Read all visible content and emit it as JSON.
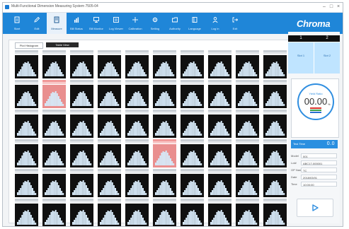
{
  "window": {
    "title": "Multi-Functional Dimension Measuring System 7505-04"
  },
  "toolbar": {
    "items": [
      {
        "label": "Start",
        "icon": "document-icon"
      },
      {
        "label": "Edit",
        "icon": "pencil-icon"
      },
      {
        "label": "Measure",
        "icon": "measure-icon",
        "active": true
      },
      {
        "label": "Bill Status",
        "icon": "bar-chart-icon"
      },
      {
        "label": "Bill Monitor",
        "icon": "monitor-icon"
      },
      {
        "label": "Log Viewer",
        "icon": "log-icon"
      },
      {
        "label": "Calibration",
        "icon": "crosshair-icon"
      },
      {
        "label": "Setting",
        "icon": "gear-icon"
      },
      {
        "label": "Authority",
        "icon": "folder-icon"
      },
      {
        "label": "Language",
        "icon": "book-icon"
      },
      {
        "label": "Log in",
        "icon": "user-icon"
      },
      {
        "label": "Exit",
        "icon": "exit-icon"
      }
    ],
    "brand": "Chroma"
  },
  "tabs": [
    "Plot Histogram",
    "Table View"
  ],
  "grid": {
    "rows": 6,
    "cols": 10,
    "highlighted": [
      [
        1,
        1
      ],
      [
        3,
        5
      ]
    ]
  },
  "right_panel": {
    "slots": [
      {
        "number": "1",
        "status": "Slot 1"
      },
      {
        "number": "2",
        "status": "Slot 2"
      }
    ],
    "gauge": {
      "label": "Yield Ratio",
      "value": "00.00",
      "unit": "%"
    },
    "test_time": {
      "label": "Test Time",
      "value": "0.0"
    },
    "info": [
      {
        "key": "Model",
        "value": "001"
      },
      {
        "key": "Lot#",
        "value": "ABC17-000001"
      },
      {
        "key": "OP Name",
        "value": "TC"
      },
      {
        "key": "Date",
        "value": "2018/03/01"
      },
      {
        "key": "Time",
        "value": "10:00:00"
      }
    ]
  },
  "colors": {
    "accent": "#1f86d8",
    "bars": "#d6e8f7",
    "plot_bg": "#101010",
    "highlight": "#e98f8f",
    "legend": [
      "#d9342b",
      "#3aa14a",
      "#2a6fd0"
    ]
  }
}
